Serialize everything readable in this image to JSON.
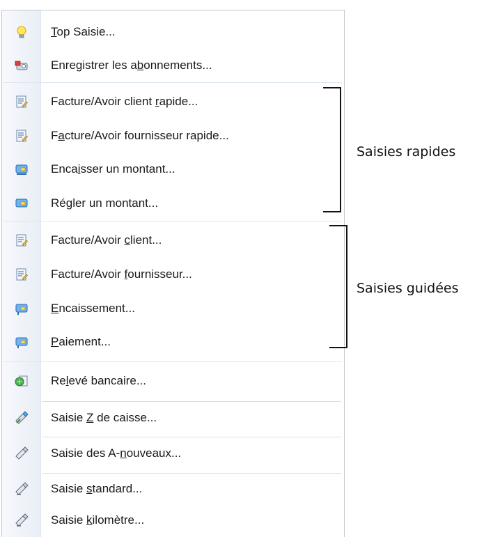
{
  "menu": {
    "items": [
      {
        "label_pre": "",
        "label_u": "T",
        "label_post": "op Saisie...",
        "icon": "lightbulb-icon"
      },
      {
        "label_pre": "Enregistrer les a",
        "label_u": "b",
        "label_post": "onnements...",
        "icon": "subscription-icon"
      },
      {
        "label_pre": "Facture/Avoir client ",
        "label_u": "r",
        "label_post": "apide...",
        "icon": "invoice-icon"
      },
      {
        "label_pre": "F",
        "label_u": "a",
        "label_post": "cture/Avoir fournisseur rapide...",
        "icon": "invoice-icon"
      },
      {
        "label_pre": "Enca",
        "label_u": "i",
        "label_post": "sser un montant...",
        "icon": "card-in-icon"
      },
      {
        "label_pre": "Ré",
        "label_u": "g",
        "label_post": "ler un montant...",
        "icon": "card-out-icon"
      },
      {
        "label_pre": "Facture/Avoir ",
        "label_u": "c",
        "label_post": "lient...",
        "icon": "invoice-icon"
      },
      {
        "label_pre": "Facture/Avoir ",
        "label_u": "f",
        "label_post": "ournisseur...",
        "icon": "invoice-icon"
      },
      {
        "label_pre": "",
        "label_u": "E",
        "label_post": "ncaissement...",
        "icon": "card-in-icon"
      },
      {
        "label_pre": "",
        "label_u": "P",
        "label_post": "aiement...",
        "icon": "card-out-icon"
      },
      {
        "label_pre": "Re",
        "label_u": "l",
        "label_post": "evé bancaire...",
        "icon": "bank-statement-icon"
      },
      {
        "label_pre": "Saisie ",
        "label_u": "Z",
        "label_post": " de caisse...",
        "icon": "pen-icon"
      },
      {
        "label_pre": "Saisie des A-",
        "label_u": "n",
        "label_post": "ouveaux...",
        "icon": "pen-icon"
      },
      {
        "label_pre": "Saisie ",
        "label_u": "s",
        "label_post": "tandard...",
        "icon": "pen-icon"
      },
      {
        "label_pre": "Saisie ",
        "label_u": "k",
        "label_post": "ilomètre...",
        "icon": "pen-icon"
      }
    ]
  },
  "annotations": {
    "rapides": "Saisies rapides",
    "guidees": "Saisies guidées"
  },
  "colors": {
    "accent_blue": "#3b7dd8",
    "gutter": "#eef2f8",
    "separator": "#d9dee6"
  }
}
